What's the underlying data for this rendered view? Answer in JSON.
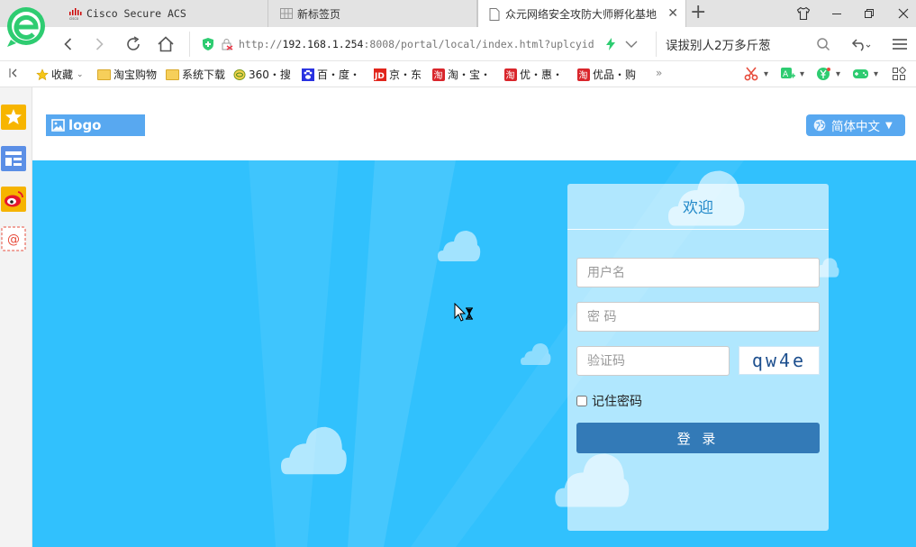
{
  "browser": {
    "tabs": [
      {
        "label": "Cisco Secure ACS"
      },
      {
        "label": "新标签页"
      },
      {
        "label": "众元网络安全攻防大师孵化基地"
      }
    ],
    "url": {
      "prefix": "http://",
      "host": "192.168.1.254",
      "path": ":8008/portal/local/index.html?uplcyid"
    },
    "search_text": "误拔别人2万多斤葱",
    "bookmarks": [
      "收藏",
      "淘宝购物",
      "系统下载",
      "360・搜",
      "百・度・",
      "京・东",
      "淘・宝・",
      "优・惠・",
      "优品・购"
    ],
    "bookmark_more": "»"
  },
  "page": {
    "logo_text": "logo",
    "language": "简体中文",
    "panel": {
      "title": "欢迎",
      "username_placeholder": "用户名",
      "password_placeholder": "密 码",
      "captcha_placeholder": "验证码",
      "captcha_text": "qw4e",
      "remember_label": "记住密码",
      "login_label": "登 录"
    }
  },
  "colors": {
    "hero": "#31c1fd",
    "login_button": "#337ab7",
    "accent": "#58a8f0"
  }
}
